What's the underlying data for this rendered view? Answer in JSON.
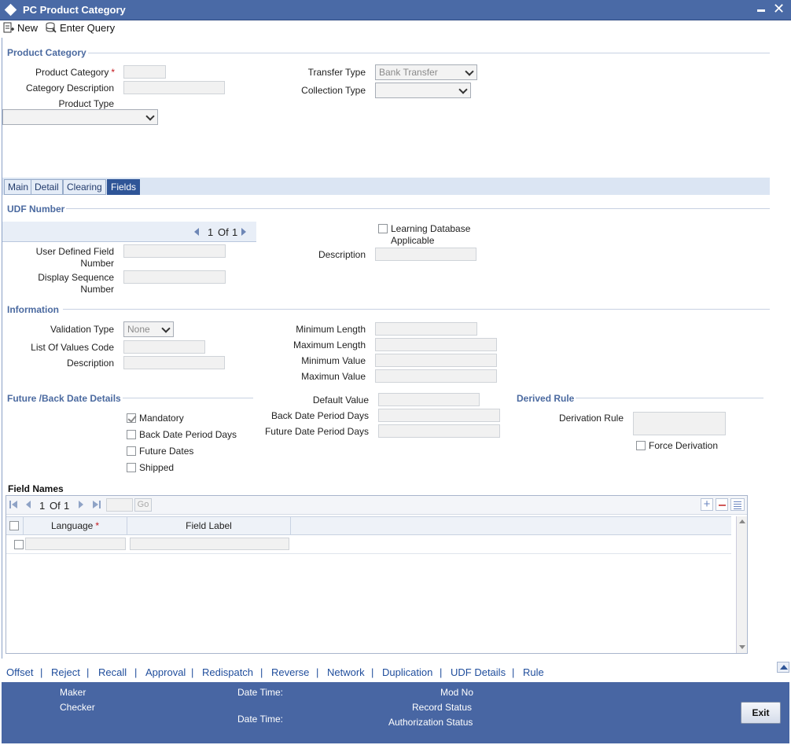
{
  "window": {
    "title": "PC Product Category"
  },
  "toolbar": {
    "new_label": "New",
    "enter_query_label": "Enter Query"
  },
  "product_category": {
    "section_title": "Product Category",
    "product_category_label": "Product Category",
    "category_description_label": "Category Description",
    "product_type_label": "Product Type",
    "transfer_type_label": "Transfer Type",
    "transfer_type_value": "Bank Transfer",
    "collection_type_label": "Collection Type",
    "collection_type_value": "",
    "product_type_value": "",
    "product_category_value": "",
    "category_description_value": ""
  },
  "tabs": [
    {
      "label": "Main",
      "active": false
    },
    {
      "label": "Detail",
      "active": false
    },
    {
      "label": "Clearing",
      "active": false
    },
    {
      "label": "Fields",
      "active": true
    }
  ],
  "udf": {
    "section_title": "UDF Number",
    "pager_current": "1",
    "pager_of": "Of",
    "pager_total": "1",
    "user_defined_field_number_label_1": "User Defined Field",
    "user_defined_field_number_label_2": "Number",
    "display_sequence_label_1": "Display Sequence",
    "display_sequence_label_2": "Number",
    "learning_db_label_1": "Learning Database",
    "learning_db_label_2": "Applicable",
    "learning_db_checked": false,
    "description_label": "Description"
  },
  "information": {
    "section_title": "Information",
    "validation_type_label": "Validation Type",
    "validation_type_value": "None",
    "list_of_values_code_label": "List Of Values Code",
    "description_label": "Description",
    "minimum_length_label": "Minimum Length",
    "maximum_length_label": "Maximum Length",
    "minimum_value_label": "Minimum Value",
    "maximum_value_label": "Maximun Value"
  },
  "future_back": {
    "section_title": "Future /Back Date Details",
    "mandatory_label": "Mandatory",
    "mandatory_checked": true,
    "back_date_period_days_label": "Back Date Period Days",
    "future_dates_label": "Future Dates",
    "shipped_label": "Shipped",
    "default_value_label": "Default Value",
    "back_date_period_days_field_label": "Back Date Period Days",
    "future_date_period_days_field_label": "Future Date Period Days"
  },
  "derived_rule": {
    "section_title": "Derived Rule",
    "derivation_rule_label": "Derivation Rule",
    "force_derivation_label": "Force Derivation",
    "force_derivation_checked": false
  },
  "field_names": {
    "section_title": "Field Names",
    "pager_current": "1",
    "pager_of": "Of",
    "pager_total": "1",
    "go_label": "Go",
    "columns": [
      "Language",
      "Field Label"
    ],
    "rows": [
      {
        "language": "",
        "field_label": ""
      }
    ]
  },
  "footer_links": [
    "Offset",
    "Reject",
    "Recall",
    "Approval",
    "Redispatch",
    "Reverse",
    "Network",
    "Duplication",
    "UDF Details",
    "Rule"
  ],
  "audit": {
    "maker_label": "Maker",
    "checker_label": "Checker",
    "date_time_label_1": "Date Time:",
    "date_time_label_2": "Date Time:",
    "mod_no_label": "Mod No",
    "record_status_label": "Record Status",
    "authorization_status_label": "Authorization Status",
    "exit_label": "Exit"
  },
  "colors": {
    "titlebar": "#4a6aa6",
    "section_text": "#4b6aa0",
    "active_tab": "#2f5597",
    "footer": "#4866a3",
    "link": "#1f4d9c",
    "required": "#c4161c"
  }
}
